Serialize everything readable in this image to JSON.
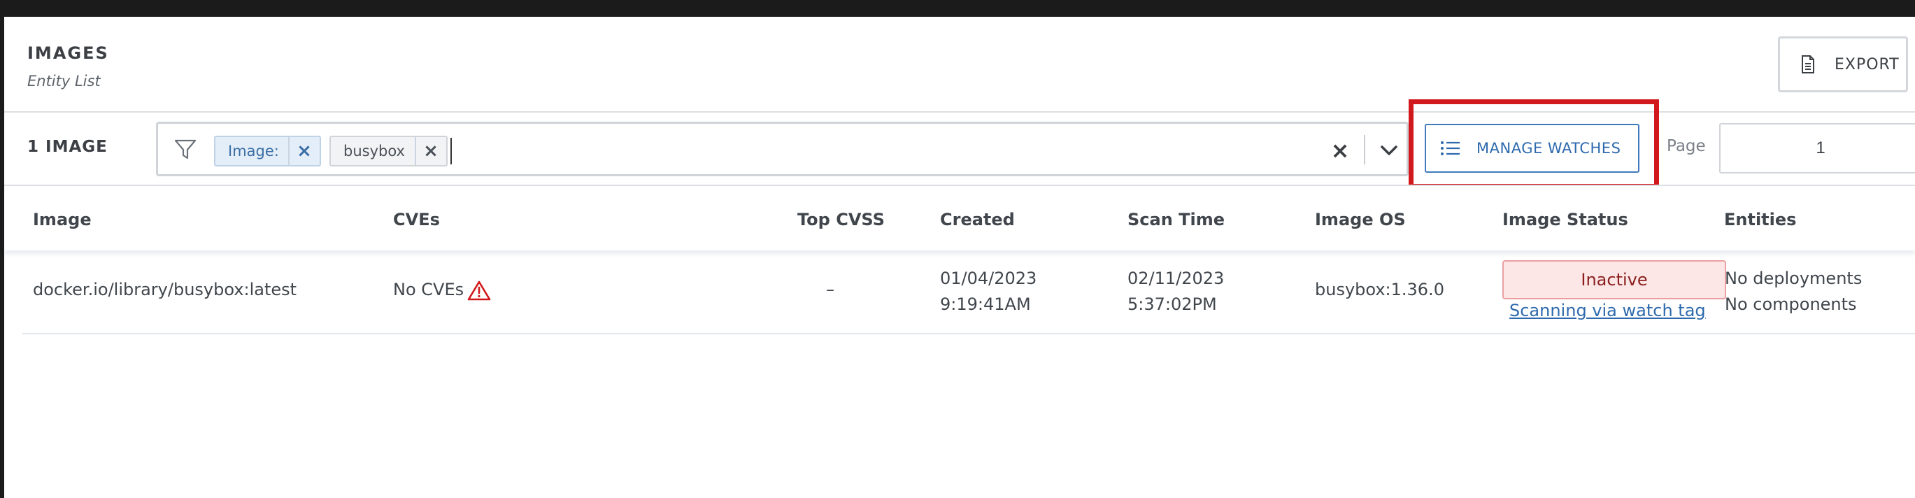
{
  "header": {
    "title": "IMAGES",
    "subtitle": "Entity List",
    "export_label": "EXPORT"
  },
  "toolbar": {
    "result_count": "1 IMAGE",
    "filter_chips": [
      {
        "label": "Image:"
      },
      {
        "label": "busybox"
      }
    ],
    "manage_watches_label": "MANAGE WATCHES",
    "page_label": "Page",
    "page_value": "1"
  },
  "table": {
    "columns": [
      "Image",
      "CVEs",
      "Top CVSS",
      "Created",
      "Scan Time",
      "Image OS",
      "Image Status",
      "Entities"
    ],
    "rows": [
      {
        "image": "docker.io/library/busybox:latest",
        "cves": "No CVEs",
        "top_cvss": "–",
        "created_date": "01/04/2023",
        "created_time": "9:19:41AM",
        "scan_date": "02/11/2023",
        "scan_time": "5:37:02PM",
        "image_os": "busybox:1.36.0",
        "status": "Inactive",
        "status_link": "Scanning via watch tag",
        "entities_deployments": "No deployments",
        "entities_components": "No components"
      }
    ]
  },
  "icons": {
    "export": "document-icon",
    "filter": "filter-icon",
    "manage_watches": "list-icon",
    "cve_warning": "warning-triangle-icon",
    "clear": "close-icon",
    "dropdown": "chevron-down-icon"
  },
  "colors": {
    "accent": "#2e6aad",
    "highlight": "#d1181c",
    "inactive_bg": "#fde6e6",
    "inactive_text": "#8a1f1f",
    "warning": "#d1181c"
  }
}
